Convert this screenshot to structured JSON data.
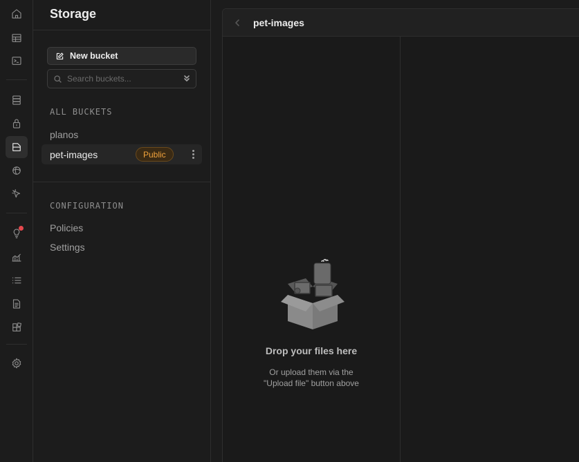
{
  "rail": {
    "items": [
      {
        "name": "home-icon"
      },
      {
        "name": "table-editor-icon"
      },
      {
        "name": "sql-editor-icon"
      },
      {
        "name": "database-icon"
      },
      {
        "name": "auth-icon"
      },
      {
        "name": "storage-icon",
        "active": true
      },
      {
        "name": "realtime-icon"
      },
      {
        "name": "edge-functions-icon"
      },
      {
        "name": "advisors-icon",
        "notification": true
      },
      {
        "name": "reports-icon"
      },
      {
        "name": "logs-icon"
      },
      {
        "name": "api-docs-icon"
      },
      {
        "name": "integrations-icon"
      },
      {
        "name": "settings-icon"
      }
    ]
  },
  "menu": {
    "title": "Storage",
    "new_bucket_label": "New bucket",
    "search_placeholder": "Search buckets...",
    "all_buckets_label": "ALL BUCKETS",
    "buckets": [
      {
        "name": "planos"
      },
      {
        "name": "pet-images",
        "badge": "Public",
        "selected": true
      }
    ],
    "configuration_label": "CONFIGURATION",
    "config_links": [
      {
        "label": "Policies"
      },
      {
        "label": "Settings"
      }
    ]
  },
  "explorer": {
    "breadcrumb": "pet-images",
    "drop_title": "Drop your files here",
    "drop_subtitle_line1": "Or upload them via the",
    "drop_subtitle_line2": "\"Upload file\" button above"
  },
  "colors": {
    "background": "#1c1c1c",
    "border": "#2e2e2e",
    "badge_text": "#f0a23c",
    "badge_bg": "#3a2a14",
    "notification": "#e5484d"
  }
}
